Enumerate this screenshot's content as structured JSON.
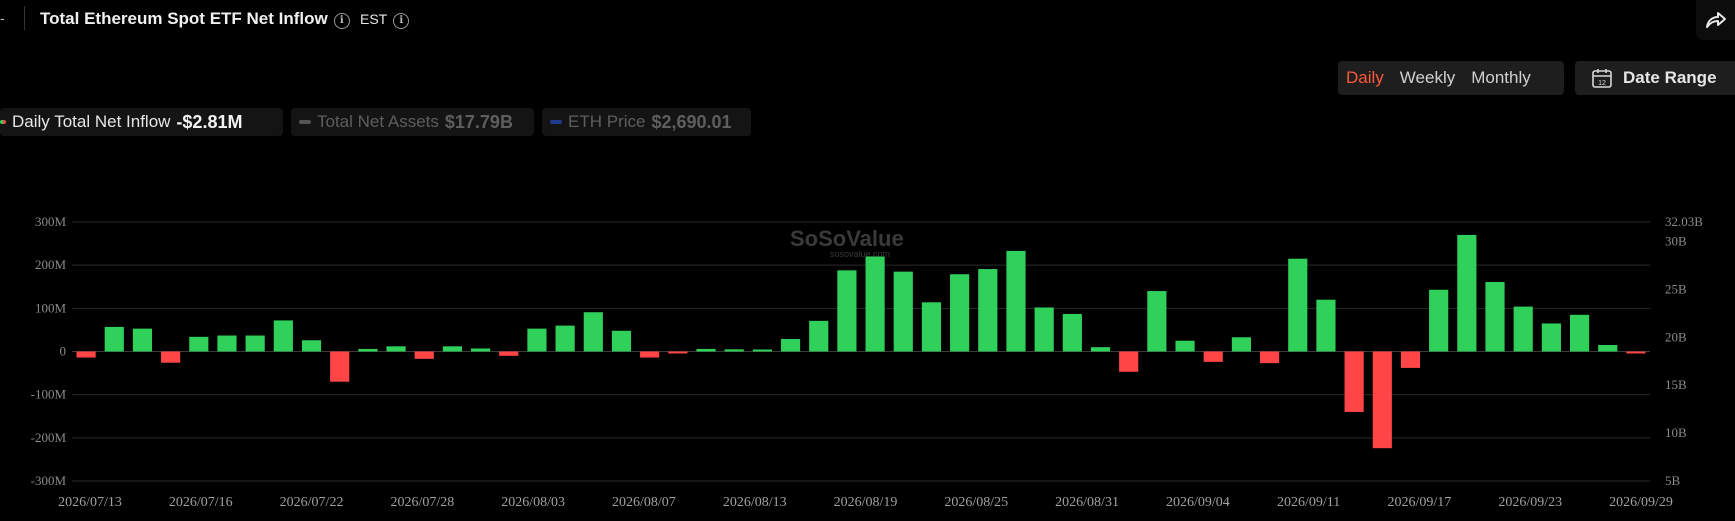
{
  "header": {
    "title": "Total Ethereum Spot ETF Net Inflow",
    "timezone": "EST",
    "left_mark": "-"
  },
  "period_tabs": [
    {
      "label": "Daily",
      "active": true
    },
    {
      "label": "Weekly",
      "active": false
    },
    {
      "label": "Monthly",
      "active": false
    }
  ],
  "date_range": {
    "label": "Date Range",
    "icon_number": "12"
  },
  "legend": [
    {
      "name": "Daily Total Net Inflow",
      "value": "-$2.81M",
      "color": "#ff4d4d",
      "active": true
    },
    {
      "name": "Total Net Assets",
      "value": "$17.79B",
      "color": "#555555",
      "active": false
    },
    {
      "name": "ETH Price",
      "value": "$2,690.01",
      "color": "#1f3a8a",
      "active": false
    }
  ],
  "watermark": {
    "brand": "SoSoValue",
    "site": "sosovalue.com"
  },
  "colors": {
    "positive": "#2fd15b",
    "negative": "#ff4545",
    "accent": "#ff5a3c"
  },
  "chart_data": {
    "type": "bar",
    "title": "Total Ethereum Spot ETF Net Inflow",
    "left_axis": {
      "ticks": [
        "300M",
        "200M",
        "100M",
        "0",
        "-100M",
        "-200M",
        "-300M"
      ],
      "ylim": [
        -300,
        300
      ],
      "unit": "M"
    },
    "right_axis": {
      "ticks": [
        "32.03B",
        "30B",
        "25B",
        "20B",
        "15B",
        "10B",
        "5B"
      ],
      "ylim": [
        5,
        32.03
      ],
      "unit": "B"
    },
    "x_tick_labels": [
      "2026/07/13",
      "2026/07/16",
      "2026/07/22",
      "2026/07/28",
      "2026/08/03",
      "2026/08/07",
      "2026/08/13",
      "2026/08/19",
      "2026/08/25",
      "2026/08/31",
      "2026/09/04",
      "2026/09/11",
      "2026/09/17",
      "2026/09/23",
      "2026/09/29"
    ],
    "grid": true,
    "series": [
      {
        "name": "Daily Total Net Inflow",
        "values": [
          -14,
          57,
          53,
          -26,
          34,
          37,
          37,
          72,
          26,
          -70,
          6,
          12,
          -17,
          12,
          7,
          -10,
          53,
          60,
          91,
          48,
          -14,
          -2,
          6,
          5,
          0,
          29,
          71,
          188,
          220,
          185,
          114,
          179,
          191,
          233,
          102,
          87,
          10,
          -47,
          140,
          25,
          -24,
          33,
          -27,
          215,
          120,
          -140,
          -224,
          -38,
          143,
          270,
          161,
          104,
          65,
          85,
          15,
          -3
        ]
      }
    ]
  }
}
